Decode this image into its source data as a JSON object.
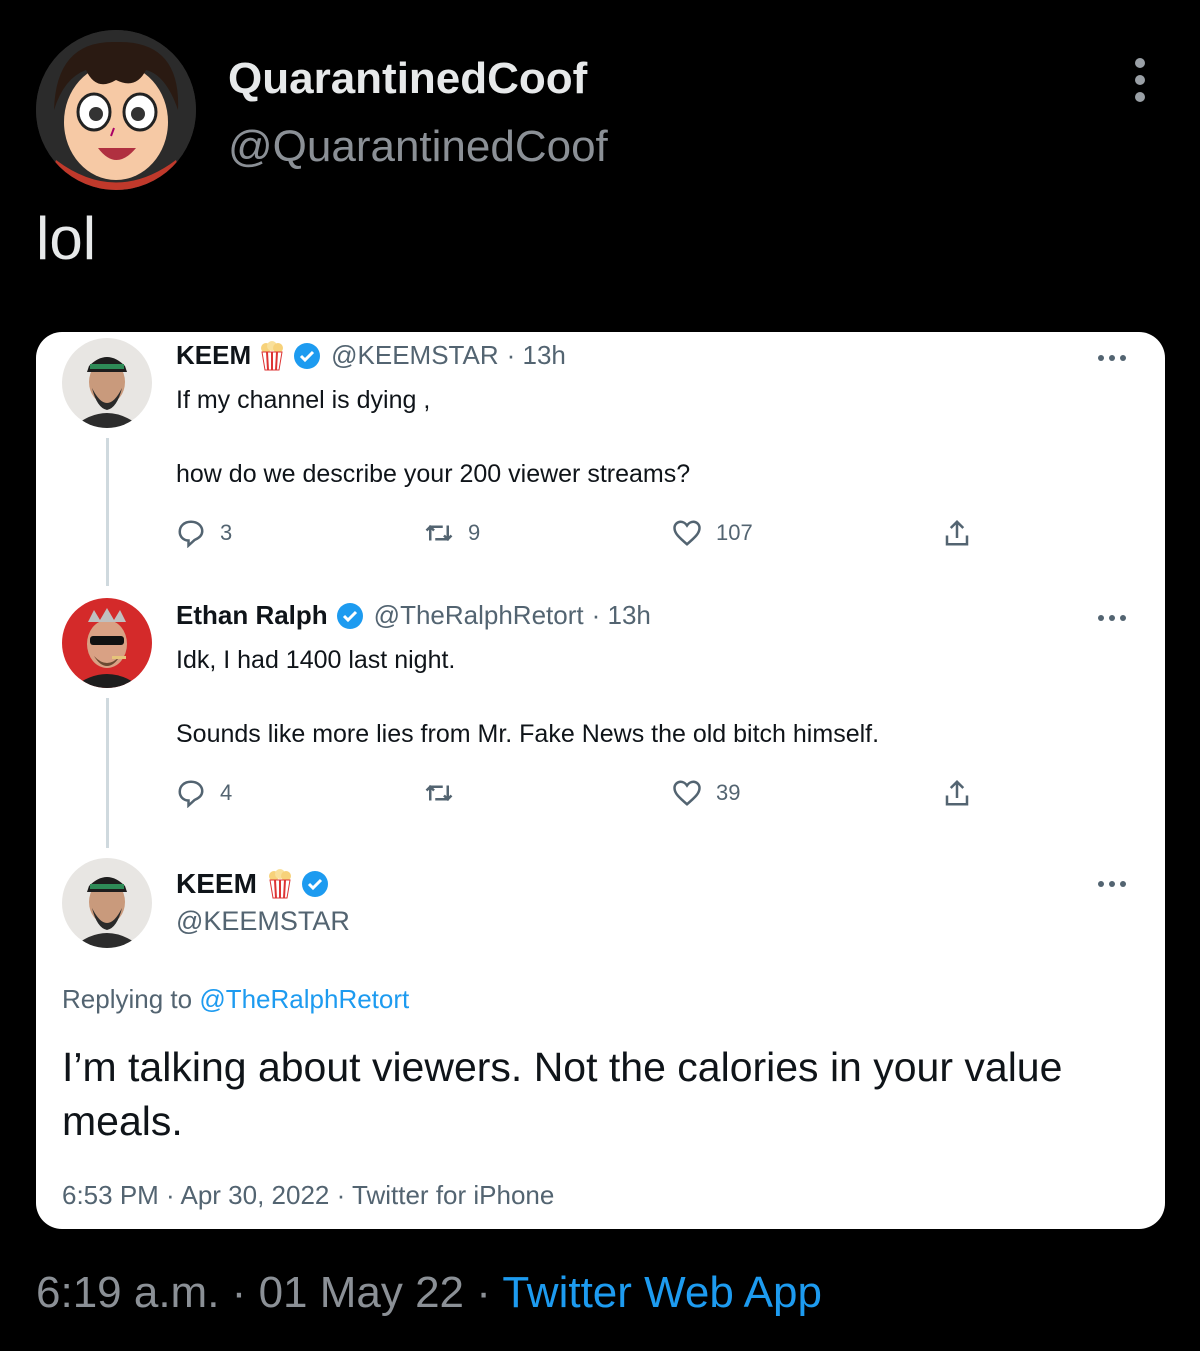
{
  "outer_tweet": {
    "display_name": "QuarantinedCoof",
    "handle": "@QuarantinedCoof",
    "text": "lol",
    "time": "6:19 a.m.",
    "date": "01 May 22",
    "app": "Twitter Web App",
    "separator": "·"
  },
  "quoted": {
    "tweets": [
      {
        "name": "KEEM",
        "handle": "@KEEMSTAR",
        "age": "· 13h",
        "line1": "If my channel is dying ,",
        "line2": "how do we describe your 200 viewer streams?",
        "replies": "3",
        "retweets": "9",
        "likes": "107"
      },
      {
        "name": "Ethan Ralph",
        "handle": "@TheRalphRetort",
        "age": "· 13h",
        "line1": "Idk, I had 1400 last night.",
        "line2": "Sounds like more lies from Mr. Fake News the old bitch himself.",
        "replies": "4",
        "retweets": "",
        "likes": "39"
      }
    ],
    "main": {
      "name": "KEEM",
      "handle": "@KEEMSTAR",
      "replying_prefix": "Replying to",
      "replying_to": "@TheRalphRetort",
      "text": "I’m talking about viewers. Not the calories in your value meals.",
      "meta": "6:53 PM · Apr 30, 2022 · Twitter for iPhone"
    }
  },
  "colors": {
    "background": "#000000",
    "card": "#ffffff",
    "accent": "#1d9bf0",
    "muted": "#8b9096"
  }
}
